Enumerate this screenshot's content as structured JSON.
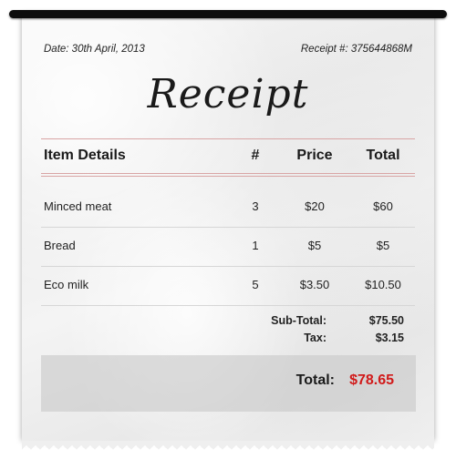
{
  "header": {
    "date": "Date: 30th April, 2013",
    "receipt_number": "Receipt #: 375644868M",
    "title": "Receipt"
  },
  "table": {
    "columns": [
      "Item Details",
      "#",
      "Price",
      "Total"
    ],
    "rows": [
      {
        "item": "Minced meat",
        "qty": "3",
        "price": "$20",
        "total": "$60"
      },
      {
        "item": "Bread",
        "qty": "1",
        "price": "$5",
        "total": "$5"
      },
      {
        "item": "Eco milk",
        "qty": "5",
        "price": "$3.50",
        "total": "$10.50"
      }
    ]
  },
  "summary": {
    "subtotal_label": "Sub-Total:",
    "subtotal_value": "$75.50",
    "tax_label": "Tax:",
    "tax_value": "$3.15",
    "total_label": "Total:",
    "total_value": "$78.65"
  },
  "colors": {
    "total_value": "#d11a1a",
    "header_rule": "#d9a5a5"
  }
}
